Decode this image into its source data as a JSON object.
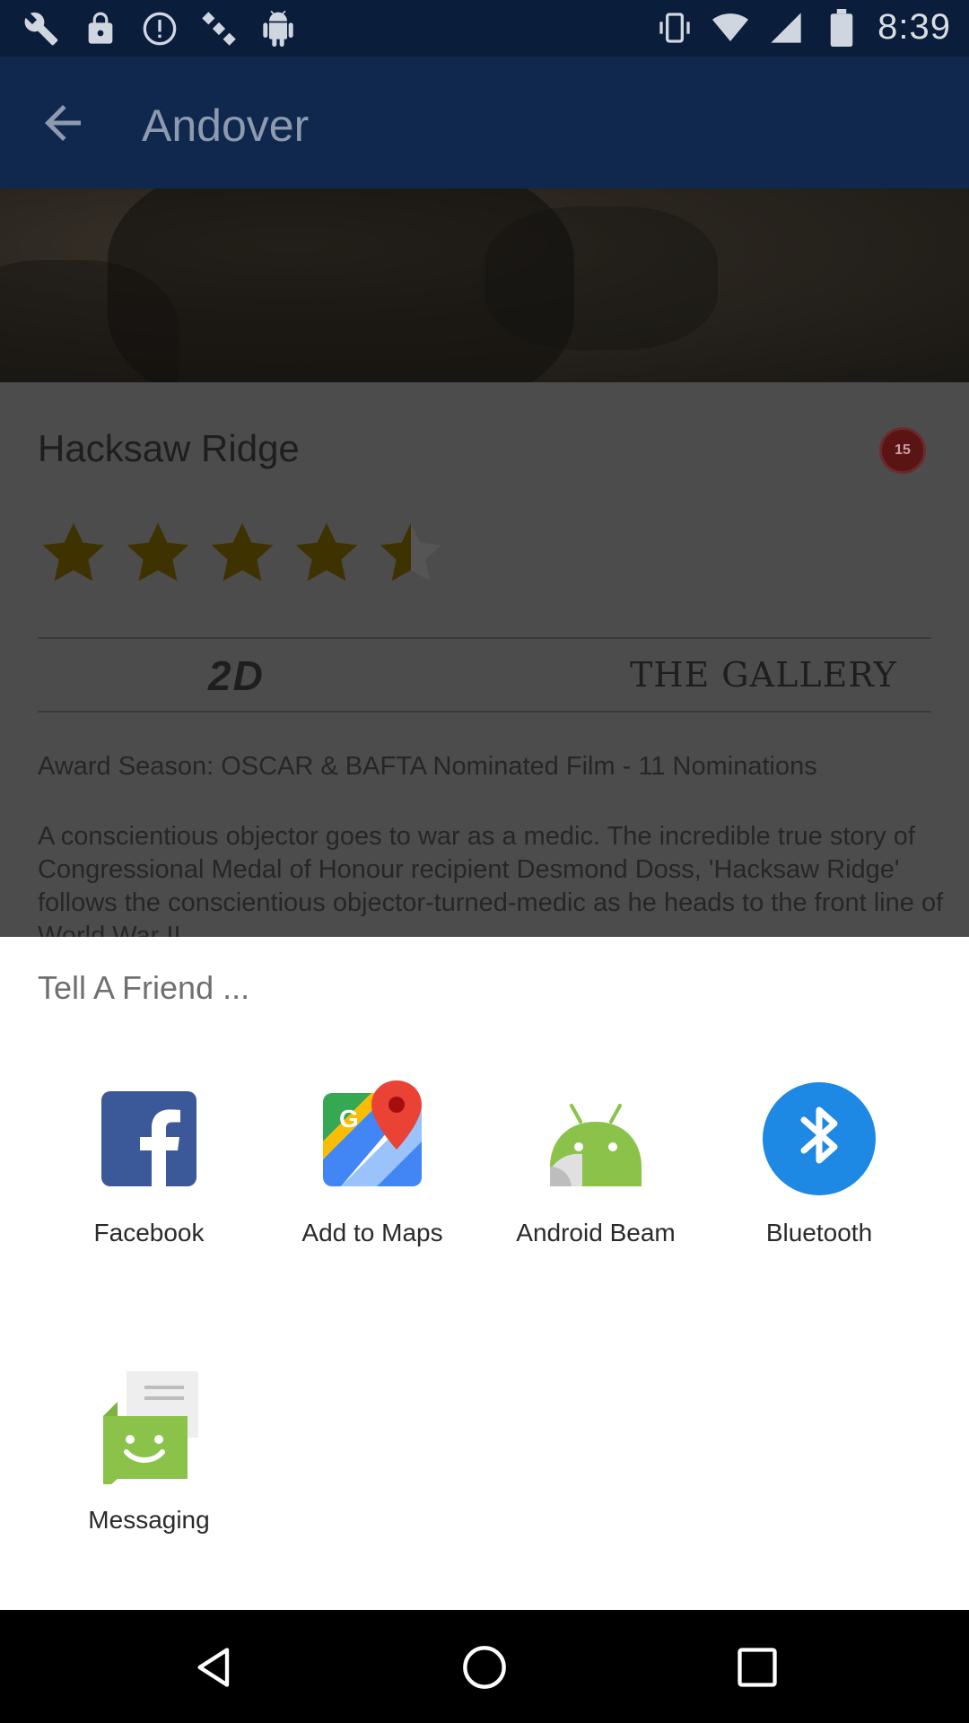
{
  "status_bar": {
    "time": "8:39",
    "left_icons": [
      "wrench-icon",
      "lock-icon",
      "alert-icon",
      "satellite-icon",
      "android-icon"
    ],
    "right_icons": [
      "vibrate-icon",
      "wifi-icon",
      "signal-icon",
      "battery-icon"
    ]
  },
  "app_bar": {
    "back_icon": "arrow-back-icon",
    "title": "Andover"
  },
  "movie": {
    "title": "Hacksaw Ridge",
    "rating_badge": "15",
    "stars": 4.5,
    "stars_max": 5,
    "format": "2D",
    "cinema": "THE GALLERY",
    "award": "Award Season: OSCAR & BAFTA Nominated Film - 11 Nominations",
    "synopsis": "A conscientious objector goes to war as a medic. The incredible true story of Congressional Medal of Honour recipient Desmond Doss, 'Hacksaw Ridge' follows the conscientious objector-turned-medic as he heads to the front line of World War II."
  },
  "share_sheet": {
    "title": "Tell A Friend ...",
    "items": [
      {
        "label": "Facebook",
        "icon": "facebook-icon"
      },
      {
        "label": "Add to Maps",
        "icon": "maps-icon"
      },
      {
        "label": "Android Beam",
        "icon": "android-beam-icon"
      },
      {
        "label": "Bluetooth",
        "icon": "bluetooth-icon"
      },
      {
        "label": "Messaging",
        "icon": "messaging-icon"
      }
    ]
  },
  "nav_bar": {
    "buttons": [
      "back-nav-icon",
      "home-nav-icon",
      "recents-nav-icon"
    ]
  },
  "colors": {
    "status_bar": "#0a1d3a",
    "app_bar": "#10284e",
    "star": "#3e3200",
    "facebook": "#3b5998",
    "bluetooth": "#1e88e5",
    "android_green": "#8bc34a"
  }
}
